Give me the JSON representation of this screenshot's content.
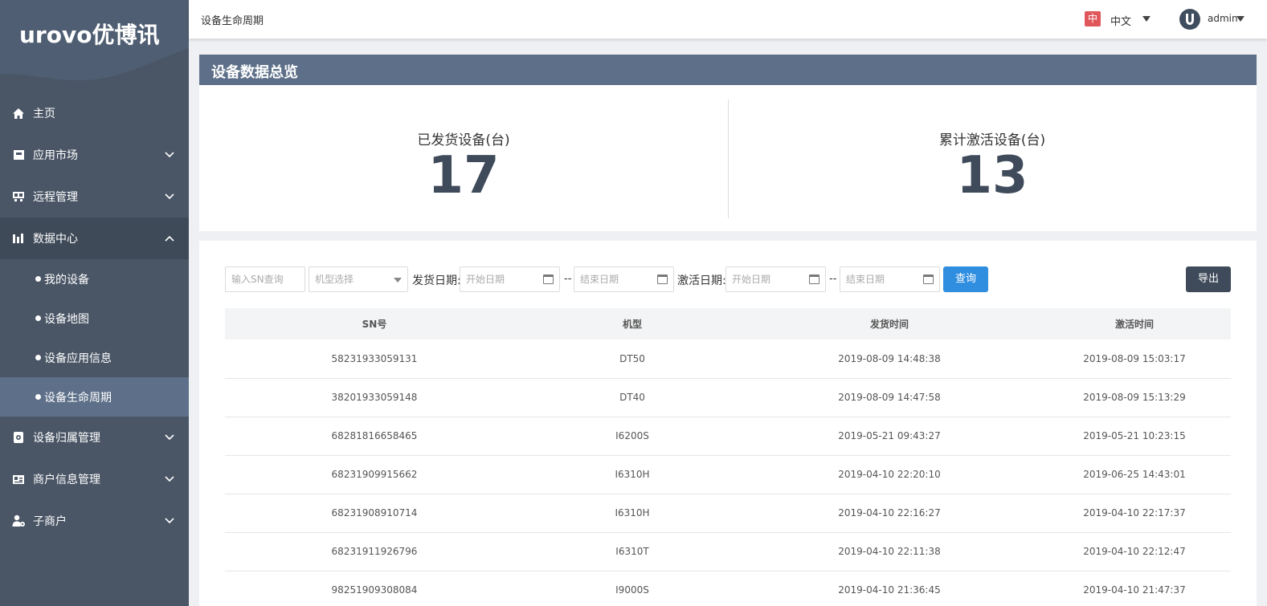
{
  "sidebar": {
    "logo_text": "urovo优博讯",
    "menu": [
      {
        "label": "主页",
        "icon": "home-icon"
      },
      {
        "label": "应用市场",
        "icon": "store-icon"
      },
      {
        "label": "远程管理",
        "icon": "remote-icon"
      },
      {
        "label": "数据中心",
        "icon": "chart-icon"
      },
      {
        "label": "设备归属管理",
        "icon": "device-owner-icon"
      },
      {
        "label": "商户信息管理",
        "icon": "merchant-card-icon"
      },
      {
        "label": "子商户",
        "icon": "user-settings-icon"
      }
    ],
    "submenu": [
      {
        "label": "我的设备"
      },
      {
        "label": "设备地图"
      },
      {
        "label": "设备应用信息"
      },
      {
        "label": "设备生命周期"
      }
    ]
  },
  "header": {
    "title": "设备生命周期",
    "lang_flag": "中",
    "lang_label": "中文",
    "user": "admin"
  },
  "overview": {
    "heading": "设备数据总览",
    "shipped_label": "已发货设备(台)",
    "shipped_value": "17",
    "activated_label": "累计激活设备(台)",
    "activated_value": "13"
  },
  "filters": {
    "sn_placeholder": "输入SN查询",
    "model_placeholder": "机型选择",
    "ship_date_label": "发货日期:",
    "activate_date_label": "激活日期:",
    "start_placeholder": "开始日期",
    "end_placeholder": "结束日期",
    "dash": "--",
    "query_button": "查询",
    "export_button": "导出"
  },
  "table": {
    "headers": [
      "SN号",
      "机型",
      "发货时间",
      "激活时间"
    ],
    "rows": [
      [
        "58231933059131",
        "DT50",
        "2019-08-09 14:48:38",
        "2019-08-09 15:03:17"
      ],
      [
        "38201933059148",
        "DT40",
        "2019-08-09 14:47:58",
        "2019-08-09 15:13:29"
      ],
      [
        "68281816658465",
        "I6200S",
        "2019-05-21 09:43:27",
        "2019-05-21 10:23:15"
      ],
      [
        "68231909915662",
        "I6310H",
        "2019-04-10 22:20:10",
        "2019-06-25 14:43:01"
      ],
      [
        "68231908910714",
        "I6310H",
        "2019-04-10 22:16:27",
        "2019-04-10 22:17:37"
      ],
      [
        "68231911926796",
        "I6310T",
        "2019-04-10 22:11:38",
        "2019-04-10 22:12:47"
      ],
      [
        "98251909308084",
        "I9000S",
        "2019-04-10 21:36:45",
        "2019-04-10 21:47:37"
      ]
    ]
  }
}
